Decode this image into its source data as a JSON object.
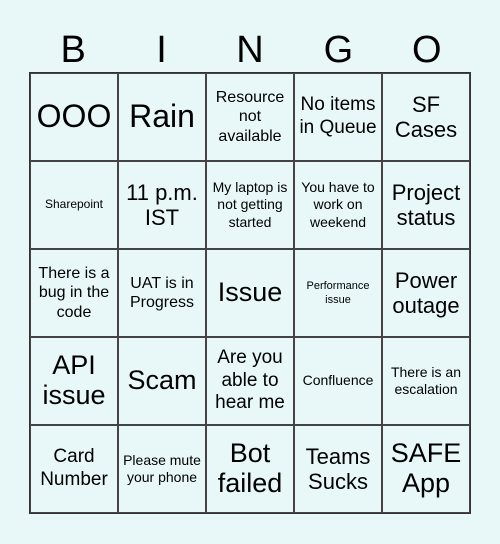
{
  "header": [
    "B",
    "I",
    "N",
    "G",
    "O"
  ],
  "cells": [
    [
      "OOO",
      "Rain",
      "Resource not available",
      "No items in Queue",
      "SF Cases"
    ],
    [
      "Sharepoint",
      "11 p.m. IST",
      "My laptop is not getting started",
      "You have to work on weekend",
      "Project status"
    ],
    [
      "There is a bug in the code",
      "UAT is in Progress",
      "Issue",
      "Performance issue",
      "Power outage"
    ],
    [
      "API issue",
      "Scam",
      "Are you able to hear me",
      "Confluence",
      "There is an escalation"
    ],
    [
      "Card Number",
      "Please mute your phone",
      "Bot failed",
      "Teams Sucks",
      "SAFE App"
    ]
  ]
}
